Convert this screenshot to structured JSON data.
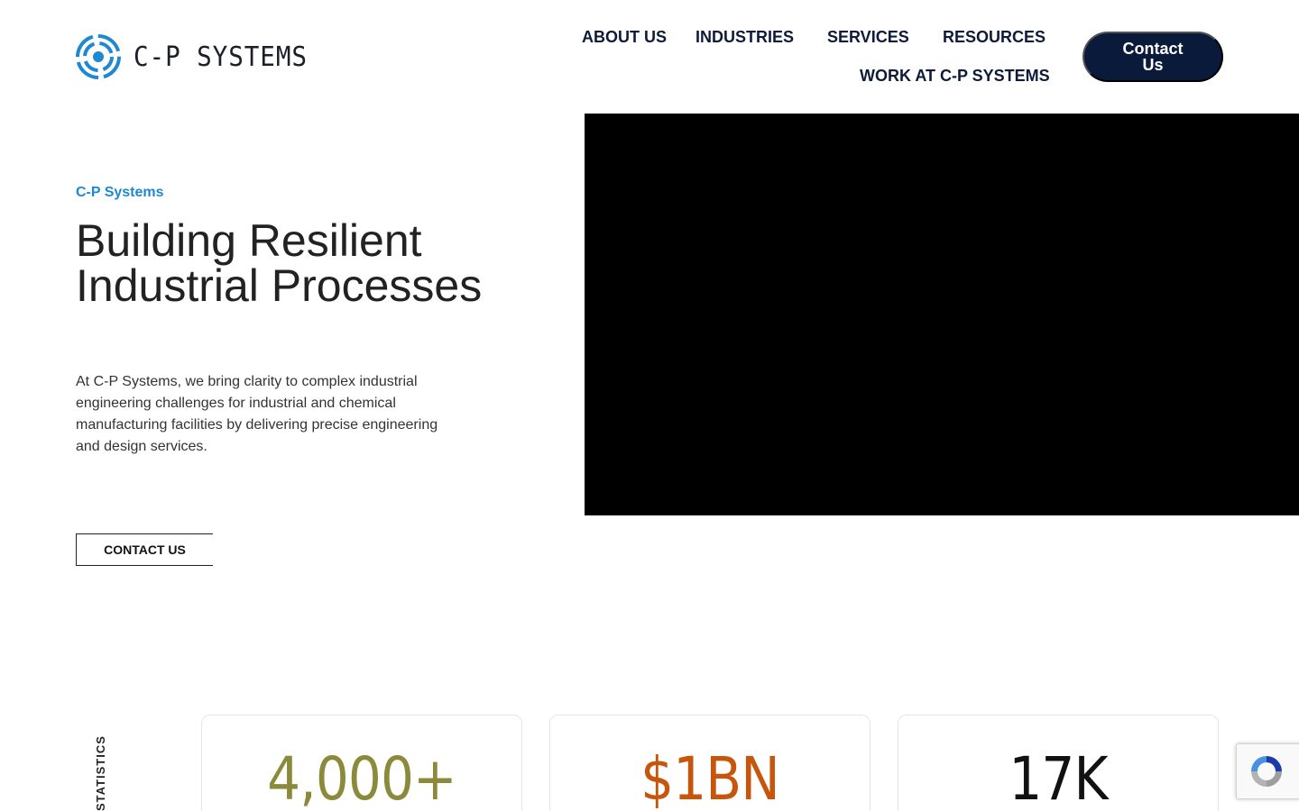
{
  "header": {
    "logo_text": "C-P SYSTEMS",
    "nav": [
      {
        "label": "ABOUT US"
      },
      {
        "label": "INDUSTRIES"
      },
      {
        "label": "SERVICES"
      },
      {
        "label": "RESOURCES"
      },
      {
        "label": "WORK AT C-P SYSTEMS"
      }
    ],
    "contact_pill": "Contact Us"
  },
  "hero": {
    "eyebrow": "C-P Systems",
    "headline": "Building Resilient Industrial Processes",
    "intro": "At C-P Systems, we bring clarity to complex industrial engineering challenges for industrial and chemical manufacturing facilities by delivering precise engineering and design services.",
    "cta": "CONTACT US"
  },
  "stats": {
    "label": "STATISTICS",
    "items": [
      {
        "value": "4,000+",
        "color": "#8a8a3a"
      },
      {
        "value": "$1BN",
        "color": "#c8550c"
      },
      {
        "value": "17K",
        "color": "#111111"
      }
    ]
  },
  "colors": {
    "accent": "#1e88d0",
    "navy": "#0a1a3a"
  },
  "icons": {
    "logo": "swirl-logo-icon",
    "recaptcha": "recaptcha-icon"
  }
}
